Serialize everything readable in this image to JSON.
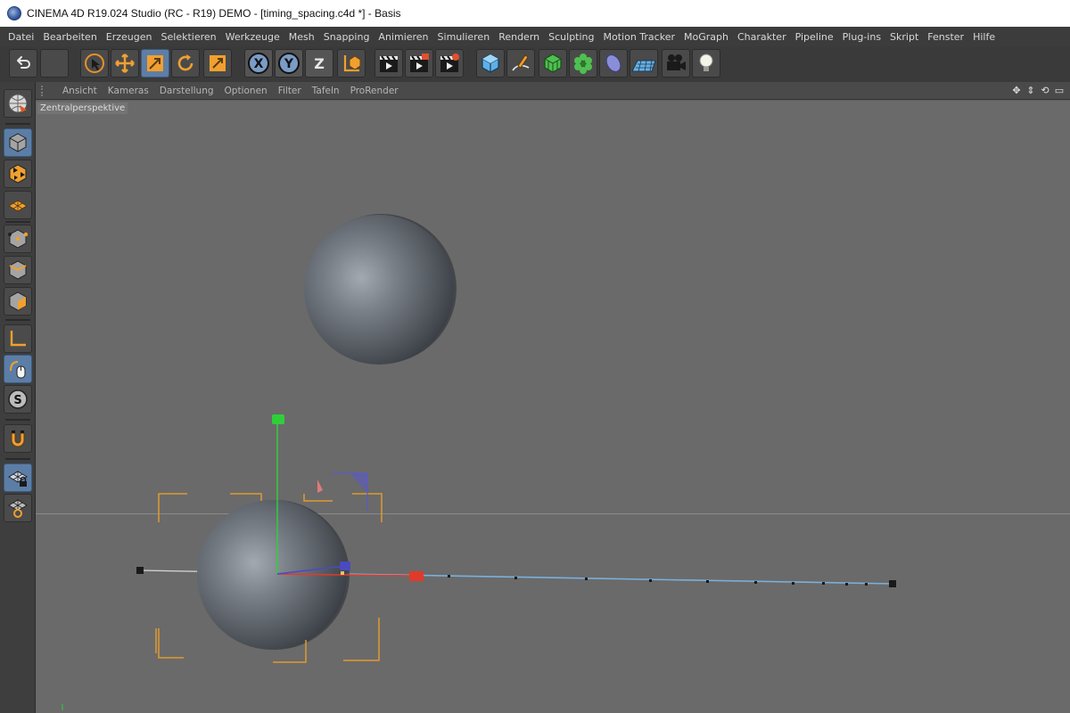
{
  "window": {
    "title": "CINEMA 4D R19.024 Studio (RC - R19) DEMO - [timing_spacing.c4d *] - Basis"
  },
  "menubar": {
    "items": [
      "Datei",
      "Bearbeiten",
      "Erzeugen",
      "Selektieren",
      "Werkzeuge",
      "Mesh",
      "Snapping",
      "Animieren",
      "Simulieren",
      "Rendern",
      "Sculpting",
      "Motion Tracker",
      "MoGraph",
      "Charakter",
      "Pipeline",
      "Plug-ins",
      "Skript",
      "Fenster",
      "Hilfe"
    ]
  },
  "toolbar": {
    "axis_x": "X",
    "axis_y": "Y",
    "axis_z": "Z",
    "icons": [
      "undo-icon",
      "live-selection-icon",
      "move-icon",
      "scale-icon",
      "rotate-icon",
      "recent-tool-icon",
      "x-axis-icon",
      "y-axis-icon",
      "z-axis-icon",
      "coordinate-system-icon",
      "render-view-icon",
      "render-picture-viewer-icon",
      "render-settings-icon",
      "cube-icon",
      "pen-spline-icon",
      "subdivision-icon",
      "cloner-icon",
      "deformer-icon",
      "floor-icon",
      "camera-icon",
      "light-icon"
    ]
  },
  "sidebar": {
    "icons": [
      "make-editable-icon",
      "model-mode-icon",
      "texture-mode-icon",
      "workplane-icon",
      "points-mode-icon",
      "edges-mode-icon",
      "polygons-mode-icon",
      "axis-mode-icon",
      "tweak-mode-icon",
      "solo-mode-icon",
      "snap-magnet-icon",
      "locked-workplane-icon",
      "workplane-plane-icon"
    ]
  },
  "viewport": {
    "menus": [
      "Ansicht",
      "Kameras",
      "Darstellung",
      "Optionen",
      "Filter",
      "Tafeln",
      "ProRender"
    ],
    "camera_label": "Zentralperspektive"
  },
  "colors": {
    "accent_active": "#5e7ea5",
    "axis_x": "#e03a2a",
    "axis_y": "#2fcf3a",
    "axis_z": "#4a4ac0",
    "bbox": "#e09a30",
    "path": "#6aa0d0"
  }
}
